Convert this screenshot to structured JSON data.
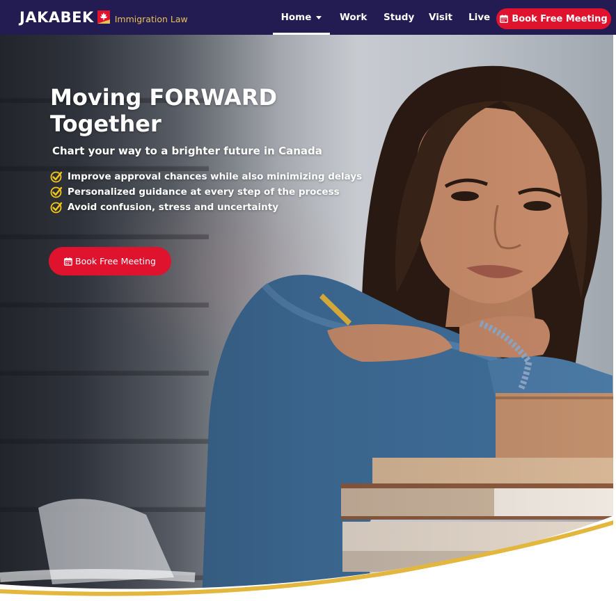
{
  "header": {
    "brand": "JAKABEK",
    "brand_sub": "Immigration Law",
    "nav": [
      {
        "label": "Home",
        "active": true,
        "has_dropdown": true
      },
      {
        "label": "Work"
      },
      {
        "label": "Study"
      },
      {
        "label": "Visit"
      },
      {
        "label": "Live"
      }
    ],
    "cta_label": "Book Free Meeting"
  },
  "hero": {
    "title_line1": "Moving FORWARD",
    "title_line2": "Together",
    "subtitle": "Chart your way to a brighter future in Canada",
    "benefits": [
      "Improve approval chances while also minimizing delays",
      "Personalized guidance at every step of the process",
      "Avoid confusion, stress and uncertainty"
    ],
    "cta_label": "Book Free Meeting"
  },
  "colors": {
    "header_bg": "#231c52",
    "accent_red": "#e0132e",
    "brand_gold": "#e8c15a",
    "check_yellow": "#f5c518"
  },
  "icons": [
    "maple-leaf-flag-icon",
    "chevron-down-icon",
    "calendar-icon",
    "check-circle-icon"
  ]
}
